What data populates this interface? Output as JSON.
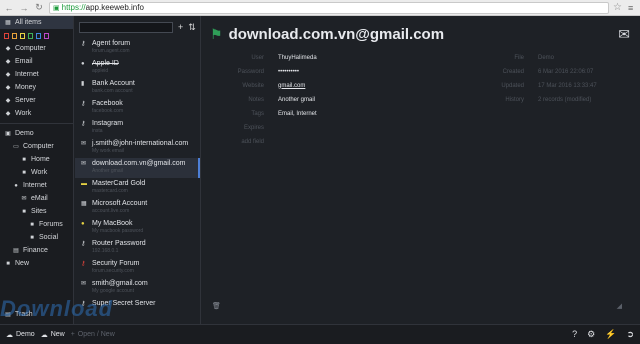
{
  "browser": {
    "scheme": "https://",
    "host": "app.keeweb.info"
  },
  "sidebar": {
    "items": [
      {
        "label": "All items",
        "icon": "grid-icon",
        "active": true
      },
      {
        "label": "Computer",
        "icon": "tag-icon"
      },
      {
        "label": "Email",
        "icon": "tag-icon"
      },
      {
        "label": "Internet",
        "icon": "tag-icon"
      },
      {
        "label": "Money",
        "icon": "tag-icon"
      },
      {
        "label": "Server",
        "icon": "tag-icon"
      },
      {
        "label": "Work",
        "icon": "tag-icon"
      }
    ],
    "color_tags": [
      "#e0443b",
      "#e8a33a",
      "#e6d243",
      "#3fb25a",
      "#3f86e0",
      "#c047c9"
    ],
    "groups": [
      {
        "label": "Demo",
        "icon": "folder-open-icon",
        "indent": 0
      },
      {
        "label": "Computer",
        "icon": "desktop-icon",
        "indent": 1
      },
      {
        "label": "Home",
        "icon": "folder-icon",
        "indent": 2
      },
      {
        "label": "Work",
        "icon": "folder-icon",
        "indent": 2
      },
      {
        "label": "Internet",
        "icon": "globe-icon",
        "indent": 1
      },
      {
        "label": "eMail",
        "icon": "envelope-icon",
        "indent": 2
      },
      {
        "label": "Sites",
        "icon": "folder-icon",
        "indent": 2
      },
      {
        "label": "Forums",
        "icon": "folder-icon",
        "indent": 3
      },
      {
        "label": "Social",
        "icon": "folder-icon",
        "indent": 3
      },
      {
        "label": "Finance",
        "icon": "money-icon",
        "indent": 1
      },
      {
        "label": "New",
        "icon": "folder-icon",
        "indent": 0
      }
    ],
    "trash": "Trash"
  },
  "list": {
    "entries": [
      {
        "title": "Agent forum",
        "desc": "forum.agent.com",
        "icon": "key-icon"
      },
      {
        "title": "Apple ID",
        "desc": "appleid",
        "icon": "apple-icon",
        "strike": true
      },
      {
        "title": "Bank Account",
        "desc": "bank.com account",
        "icon": "bank-icon"
      },
      {
        "title": "Facebook",
        "desc": "facebook.com",
        "icon": "key-icon"
      },
      {
        "title": "Instagram",
        "desc": "insta",
        "icon": "key-icon"
      },
      {
        "title": "j.smith@john-international.com",
        "desc": "My work email",
        "icon": "envelope-icon"
      },
      {
        "title": "download.com.vn@gmail.com",
        "desc": "Another gmail",
        "icon": "envelope-icon",
        "selected": true
      },
      {
        "title": "MasterCard Gold",
        "desc": "mastercard.com",
        "icon": "card-icon",
        "color": "#e6d243"
      },
      {
        "title": "Microsoft Account",
        "desc": "account.live.com",
        "icon": "windows-icon"
      },
      {
        "title": "My MacBook",
        "desc": "My macbook password",
        "icon": "apple-icon",
        "color": "#e6d243"
      },
      {
        "title": "Router Password",
        "desc": "192.168.0.1",
        "icon": "key-icon"
      },
      {
        "title": "Security Forum",
        "desc": "forum.security.com",
        "icon": "key-icon",
        "color": "#e0443b"
      },
      {
        "title": "smith@gmail.com",
        "desc": "My google account",
        "icon": "envelope-icon"
      },
      {
        "title": "Super Secret Server",
        "desc": "",
        "icon": "key-icon"
      }
    ]
  },
  "detail": {
    "title": "download.com.vn@gmail.com",
    "fields": [
      {
        "label": "User",
        "value": "ThuyHalimeda"
      },
      {
        "label": "Password",
        "value": "••••••••••"
      },
      {
        "label": "Website",
        "value": "gmail.com",
        "underline": true
      },
      {
        "label": "Notes",
        "value": "Another gmail"
      },
      {
        "label": "Tags",
        "value": "Email, Internet"
      },
      {
        "label": "Expires",
        "value": ""
      },
      {
        "label": "add field",
        "value": ""
      }
    ],
    "meta": [
      {
        "label": "File",
        "value": "Demo"
      },
      {
        "label": "Created",
        "value": "6 Mar 2016 22:06:07"
      },
      {
        "label": "Updated",
        "value": "17 Mar 2016 13:33:47"
      },
      {
        "label": "History",
        "value": "2 records (modified)"
      }
    ]
  },
  "footer": {
    "file_label": "Demo",
    "new_label": "New",
    "open_label": "Open / New"
  },
  "watermark": "Download",
  "dot_colors": [
    "#1e5c9a",
    "#7a7a7a",
    "#5a8a2a",
    "#b07a10",
    "#1e5c9a",
    "#b02a2a"
  ]
}
